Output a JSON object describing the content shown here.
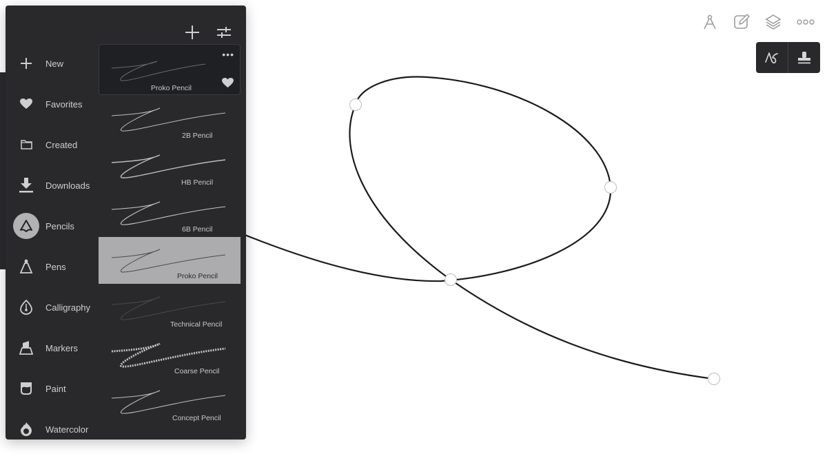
{
  "panel": {
    "add_button_icon": "plus-icon",
    "settings_button_icon": "sliders-icon",
    "categories": [
      {
        "label": "New",
        "icon": "plus-icon",
        "selected": false
      },
      {
        "label": "Favorites",
        "icon": "heart-icon",
        "selected": false
      },
      {
        "label": "Created",
        "icon": "folder-icon",
        "selected": false
      },
      {
        "label": "Downloads",
        "icon": "download-icon",
        "selected": false
      },
      {
        "label": "Pencils",
        "icon": "pencil-tip-icon",
        "selected": true
      },
      {
        "label": "Pens",
        "icon": "pen-icon",
        "selected": false
      },
      {
        "label": "Calligraphy",
        "icon": "calligraphy-nib-icon",
        "selected": false
      },
      {
        "label": "Markers",
        "icon": "marker-icon",
        "selected": false
      },
      {
        "label": "Paint",
        "icon": "paint-icon",
        "selected": false
      },
      {
        "label": "Watercolor",
        "icon": "watercolor-drop-icon",
        "selected": false
      }
    ],
    "featured_brush": {
      "label": "Proko Pencil",
      "more_icon": "more-dots-icon",
      "favorite_icon": "heart-icon",
      "favorited": true
    },
    "brushes": [
      {
        "label": "2B Pencil",
        "selected": false
      },
      {
        "label": "HB Pencil",
        "selected": false
      },
      {
        "label": "6B Pencil",
        "selected": false
      },
      {
        "label": "Proko Pencil",
        "selected": true
      },
      {
        "label": "Technical Pencil",
        "selected": false
      },
      {
        "label": "Coarse Pencil",
        "selected": false
      },
      {
        "label": "Concept Pencil",
        "selected": false
      }
    ]
  },
  "toolbar": {
    "icons": [
      "compass-icon",
      "edit-note-icon",
      "layers-icon",
      "more-icon"
    ]
  },
  "mode_toggle": {
    "items": [
      {
        "icon": "freehand-stroke-icon",
        "active": true
      },
      {
        "icon": "stamp-icon",
        "active": false
      }
    ]
  },
  "colors": {
    "panel_bg": "#29292c",
    "selected_bg": "#acacae",
    "stroke": "#1a1a1a"
  }
}
